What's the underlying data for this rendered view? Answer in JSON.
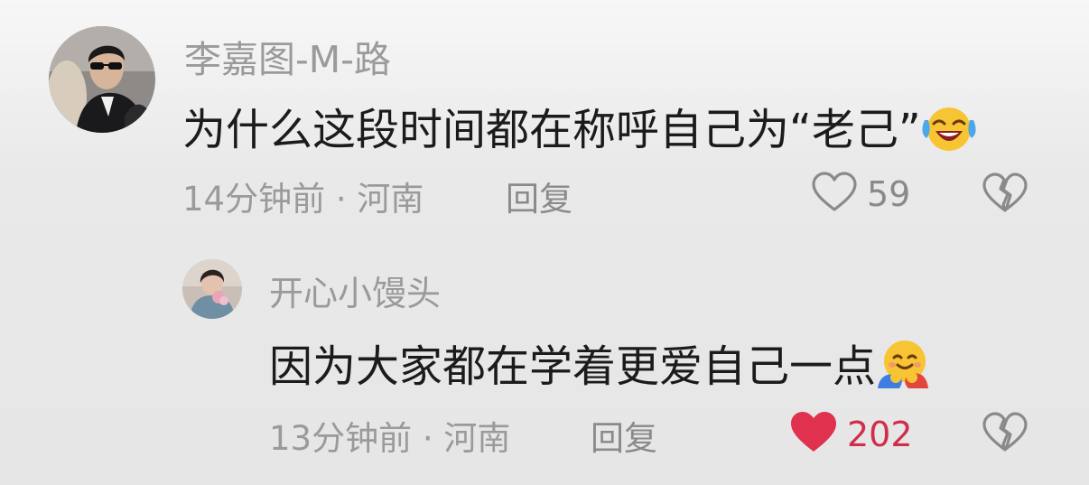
{
  "comments": [
    {
      "username": "李嘉图-M-路",
      "text": "为什么这段时间都在称呼自己为“老己”",
      "emoji": "laughing-crying-face",
      "time": "14分钟前",
      "separator": "·",
      "location": "河南",
      "reply_label": "回复",
      "like_count": "59",
      "liked": false
    },
    {
      "username": "开心小馒头",
      "text": "因为大家都在学着更爱自己一点",
      "emoji": "hugging-face",
      "time": "13分钟前",
      "separator": "·",
      "location": "河南",
      "reply_label": "回复",
      "like_count": "202",
      "liked": true
    }
  ],
  "colors": {
    "liked_heart": "#e0314f",
    "like_count_liked": "#d12c4a",
    "muted_text": "#9a9a9a",
    "body_text": "#1b1b1b"
  }
}
